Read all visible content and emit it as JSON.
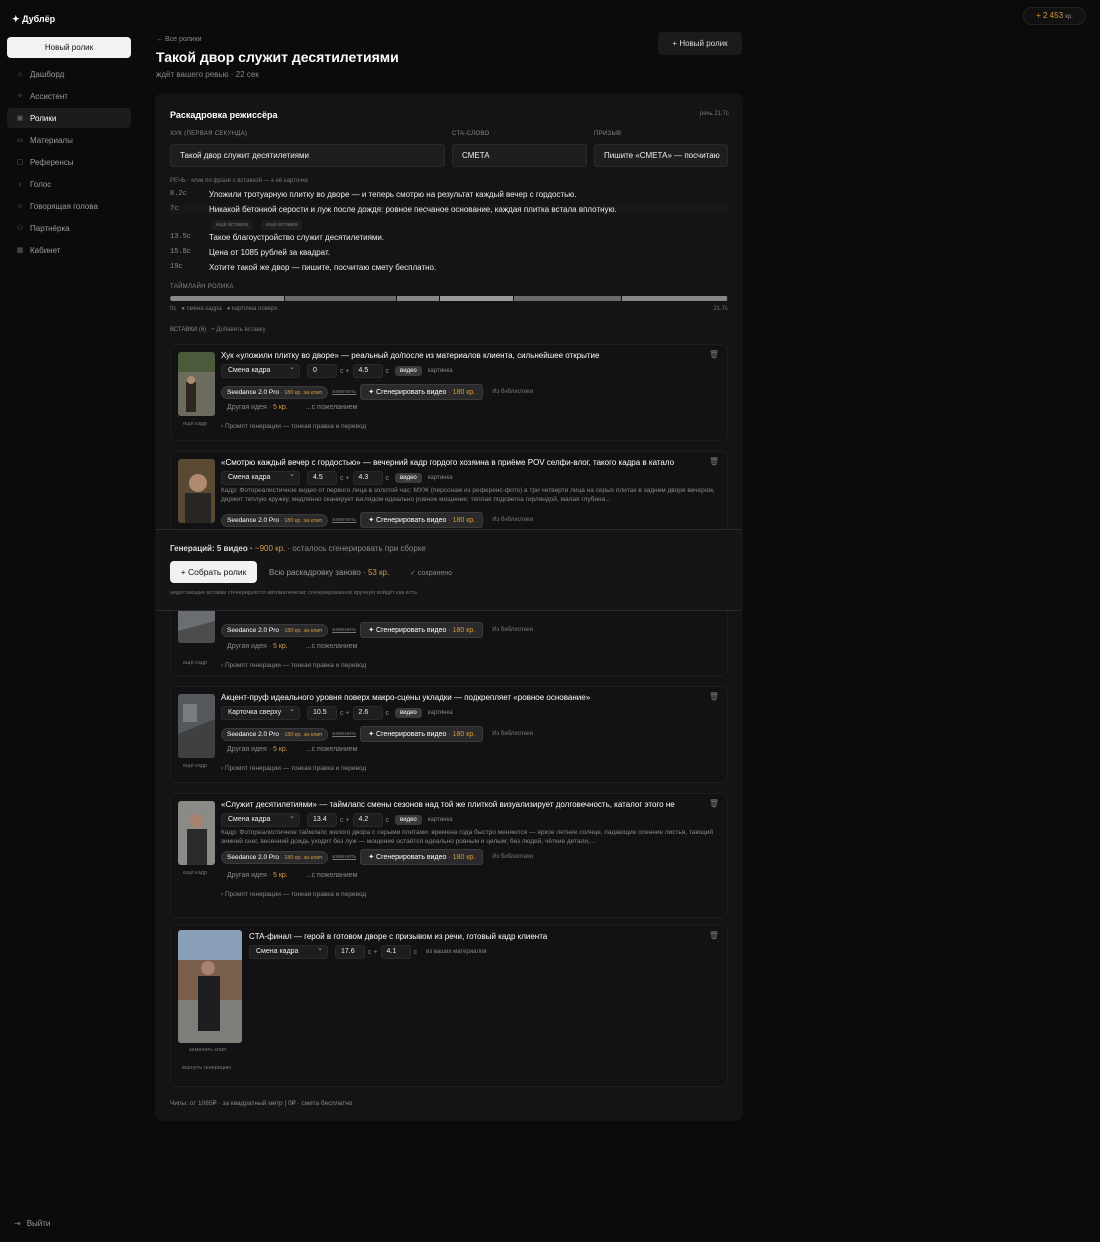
{
  "app": {
    "name": "Дублёр",
    "new_video": "Новый ролик"
  },
  "nav": [
    {
      "label": "Дашборд",
      "icon": "home-icon"
    },
    {
      "label": "Ассистент",
      "icon": "sparkle-icon"
    },
    {
      "label": "Ролики",
      "icon": "film-icon",
      "active": true
    },
    {
      "label": "Материалы",
      "icon": "folder-icon"
    },
    {
      "label": "Референсы",
      "icon": "image-icon"
    },
    {
      "label": "Голос",
      "icon": "mic-icon"
    },
    {
      "label": "Говорящая голова",
      "icon": "person-icon"
    },
    {
      "label": "Партнёрка",
      "icon": "users-icon"
    },
    {
      "label": "Кабинет",
      "icon": "grid-icon"
    }
  ],
  "logout": "Выйти",
  "credits": {
    "value": "2 453",
    "unit": "кр."
  },
  "header": {
    "back": "← Все ролики",
    "title": "Такой двор служит десятилетиями",
    "subtitle": "ждёт вашего ревью · 22 сек",
    "new_button": "Новый ролик"
  },
  "storyboard": {
    "title": "Раскадровка режиссёра",
    "speech_len": "речь 21.7с",
    "hook_label": "ХУК (ПЕРВАЯ СЕКУНДА)",
    "hook": "Такой двор служит десятилетиями",
    "cta_word_label": "CTA-СЛОВО",
    "cta_word": "СМЕТА",
    "cta_label": "ПРИЗЫВ",
    "cta": "Пишите «СМЕТА» — посчитаю",
    "speech_label": "РЕЧЬ · клик по фразе с вставкой — к её карточке",
    "lines": [
      {
        "t": "8.2с",
        "text": "Уложили тротуарную плитку во дворе — и теперь смотрю на результат каждый вечер с гордостью."
      },
      {
        "t": "7с",
        "text": "Никакой бетонной серости и луж после дождя: ровное песчаное основание, каждая плитка встала вплотную."
      },
      {
        "t": "13.5с",
        "text": "Такое благоустройство служит десятилетиями."
      },
      {
        "t": "15.8с",
        "text": "Цена от 1085 рублей за квадрат."
      },
      {
        "t": "19с",
        "text": "Хотите такой же двор — пишите, посчитаю смету бесплатно."
      }
    ],
    "sub_tags": [
      "ещё вставка",
      "ещё вставка"
    ],
    "timeline_label": "ТАЙМЛАЙН РОЛИКА",
    "timeline_start": "0с",
    "legend_cut": "смена кадра",
    "legend_overlay": "карточка поверх",
    "timeline_end": "21.7с",
    "inserts_label": "ВСТАВКИ (6)",
    "add_insert": "+ Добавить вставку",
    "footer": "Чипы: от 1085₽ · за квадратный метр | 0₽ · смета бесплатно"
  },
  "common": {
    "s": "с",
    "plus": "+",
    "video": "видео",
    "picture": "картинка",
    "model": "Seedance 2.0 Pro",
    "model_price": "· 180 кр. за клип",
    "change": "изменить",
    "generate": "Сгенерировать видео",
    "gen_price": "· 180 кр.",
    "library": "Из библиотеки",
    "other_idea": "Другая идея ·",
    "idea_price": "5 кр.",
    "wish": "...с пожеланием",
    "prompt": "› Промпт генерации — тонкая правка и перевод",
    "more_frame": "ещё кадр"
  },
  "cards": [
    {
      "title": "Хук «уложили плитку во дворе» — реальный до/после из материалов клиента, сильнейшее открытие",
      "type": "Смена кадра",
      "start": "0",
      "dur": "4.5"
    },
    {
      "title": "«Смотрю каждый вечер с гордостью» — вечерний кадр гордого хозяина в приёме POV селфи-влог, такого кадра в катало",
      "type": "Смена кадра",
      "start": "4.5",
      "dur": "4.3",
      "desc": "Кадр: Фотореалистичное видео от первого лица в золотой час: МУЖ (персонаж из референс-фото) в три четверти лица на серых плитах в заднем дворе вечером, держит теплую кружку, медленно сканирует взглядом идеально ровное мощение; теплая подсветка гирляндой, малая глубина..."
    },
    {
      "title": "",
      "type": "Смена кадра",
      "start": "",
      "dur": ""
    },
    {
      "title": "Акцент-пруф идеального уровня поверх макро-сцены укладки — подкрепляет «ровное основание»",
      "type": "Карточка сверху",
      "start": "10.5",
      "dur": "2.6"
    },
    {
      "title": "«Служит десятилетиями» — таймлапс смены сезонов над той же плиткой визуализирует долговечность, каталог этого не",
      "type": "Смена кадра",
      "start": "13.4",
      "dur": "4.2",
      "desc": "Кадр: Фотореалистичное таймлапс жилого двора с серыми плитами: времена года быстро меняются — яркое летнее солнце, падающие осенние листья, тающий зимний снег, весенний дождь уходит без луж — мощение остаётся идеально ровным и целым; без людей, чёткие детали,..."
    },
    {
      "title": "CTA-финал — герой в готовом дворе с призывом из речи, готовый кадр клиента",
      "type": "Смена кадра",
      "start": "17.6",
      "dur": "4.1",
      "src": "из ваших материалов",
      "replace": "заменить клип",
      "revert": "вернуть генерацию"
    }
  ],
  "bottom_bar": {
    "gen_label": "Генераций: 5 видео ·",
    "gen_cost": "~900 кр.",
    "gen_rest": "· осталось сгенерировать при сборке",
    "assemble": "+ Собрать ролик",
    "again": "Всю раскадровку заново ·",
    "again_cost": "53 кр.",
    "saved": "✓ сохранено",
    "note": "недостающие вставки сгенерируются автоматически; сгенерированное вручную войдёт как есть."
  }
}
